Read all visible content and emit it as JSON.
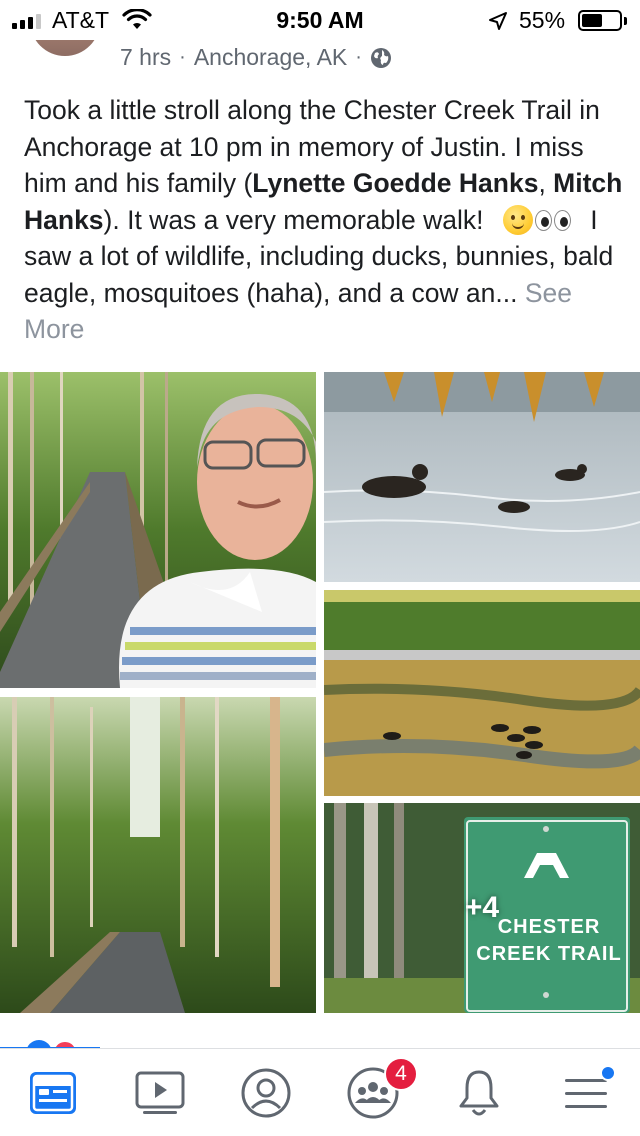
{
  "status_bar": {
    "carrier": "AT&T",
    "time": "9:50 AM",
    "battery_percent": "55%",
    "battery_level": 0.55,
    "icons": [
      "signal-icon",
      "wifi-icon",
      "location-arrow-icon",
      "battery-icon"
    ]
  },
  "post": {
    "time_ago": "7 hrs",
    "location": "Anchorage, AK",
    "separator": "·",
    "privacy_icon": "globe-icon",
    "text_part1": "Took a little stroll along the Chester Creek Trail in Anchorage at 10 pm in memory of Justin.  I miss him and his family (",
    "tag1": "Lynette Goedde Hanks",
    "comma": ", ",
    "tag2": "Mitch Hanks",
    "text_part2": ").  It was a very memorable walk! ",
    "text_part3": " I saw a lot of wildlife, including ducks, bunnies, bald eagle, mosquitoes (haha), and a cow an...",
    "see_more": "See More",
    "emojis": [
      "slightly-smiling-face",
      "eyes"
    ]
  },
  "photos": {
    "more_count": "+4",
    "sign_line1": "CHESTER",
    "sign_line2": "CREEK TRAIL"
  },
  "tab_bar": {
    "tabs": [
      "news-feed-icon",
      "watch-icon",
      "profile-icon",
      "groups-icon",
      "notifications-icon",
      "menu-icon"
    ],
    "groups_badge": "4",
    "active_color": "#1877f2"
  }
}
